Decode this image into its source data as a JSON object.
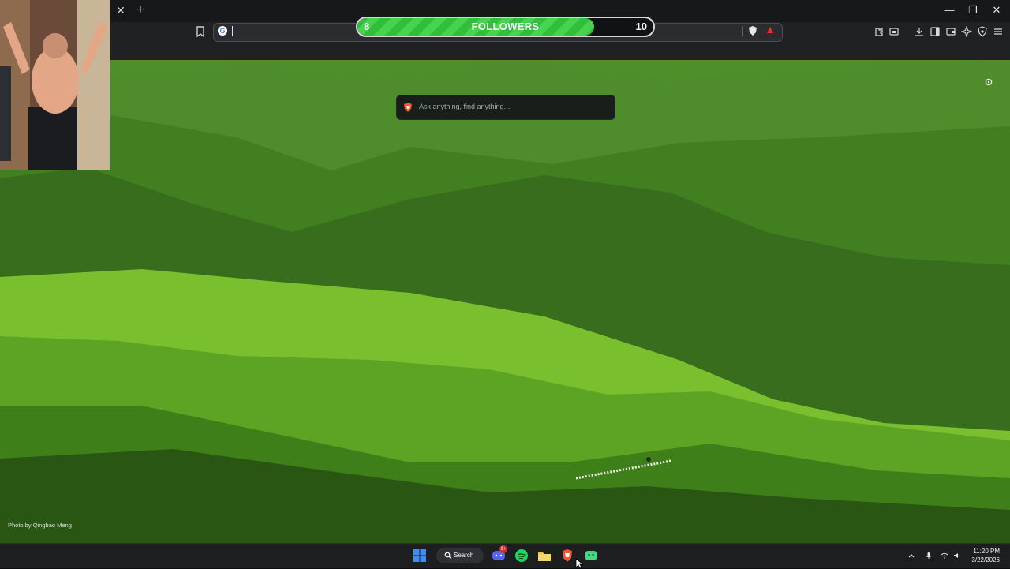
{
  "browser": {
    "tab_close_glyph": "✕",
    "new_tab_glyph": "+",
    "window_controls": [
      "—",
      "❐",
      "✕"
    ],
    "omnibox_icon": "G"
  },
  "followers_goal": {
    "current": "8",
    "label": "FOLLOWERS",
    "goal": "10",
    "progress_fraction": 0.8,
    "fill_color": "#47d24f"
  },
  "new_tab": {
    "search_placeholder": "Ask anything, find anything...",
    "photo_credit": "Photo by Qingbao Meng",
    "settings_icon": "gear-icon"
  },
  "taskbar": {
    "search_label": "Search",
    "apps": [
      "windows-start-icon",
      "discord-icon",
      "spotify-icon",
      "file-explorer-icon",
      "brave-browser-icon",
      "android-app-icon"
    ],
    "discord_badge": "9+",
    "time": "11:20 PM",
    "date": "3/22/2026"
  }
}
